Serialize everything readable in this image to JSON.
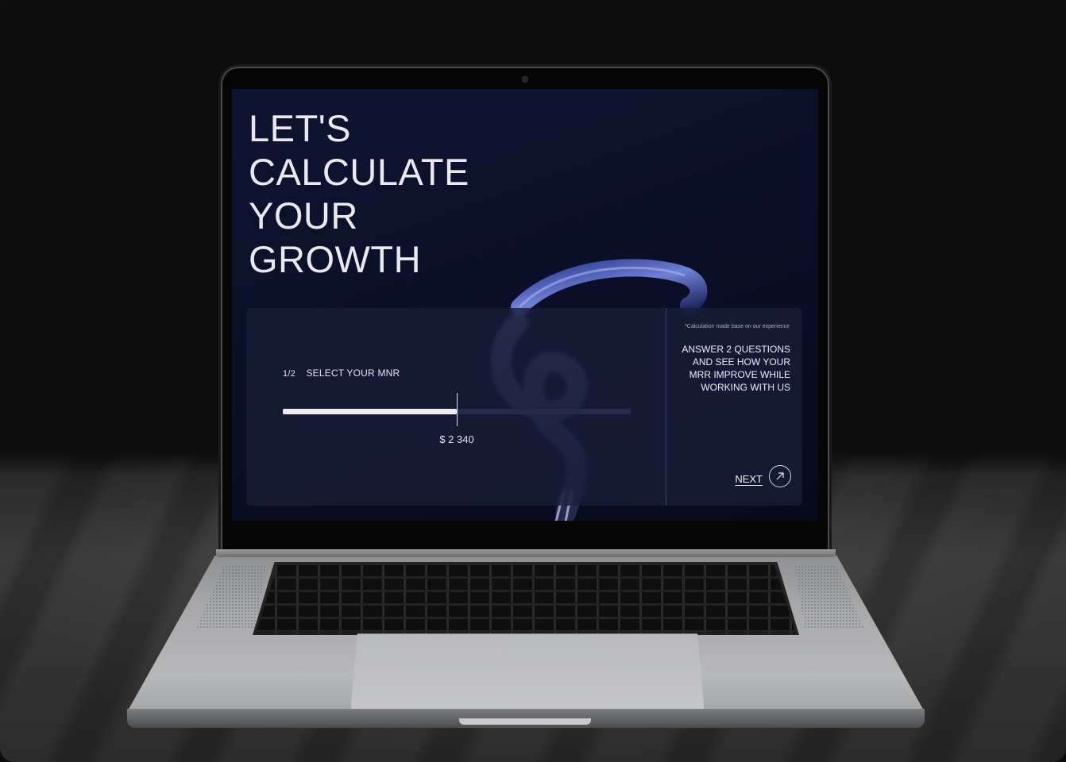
{
  "screen": {
    "headline": [
      "LET'S",
      "CALCULATE",
      "YOUR",
      "GROWTH"
    ],
    "calculator": {
      "step_count": "1/2",
      "step_label": "SELECT YOUR MNR",
      "slider_fraction": 0.5,
      "slider_value_label": "$ 2 340",
      "note": "*Calculation made base on our experience",
      "cta_text": "ANSWER 2 QUESTIONS AND SEE HOW YOUR MRR IMPROVE WHILE WORKING WITH US",
      "next_label": "NEXT"
    }
  },
  "icons": {
    "next": "arrow-up-right-icon"
  },
  "colors": {
    "screen_bg": "#0b1029",
    "panel_bg": "#181e38",
    "text": "#e9e9ef",
    "slider_fill": "#ececf2"
  }
}
